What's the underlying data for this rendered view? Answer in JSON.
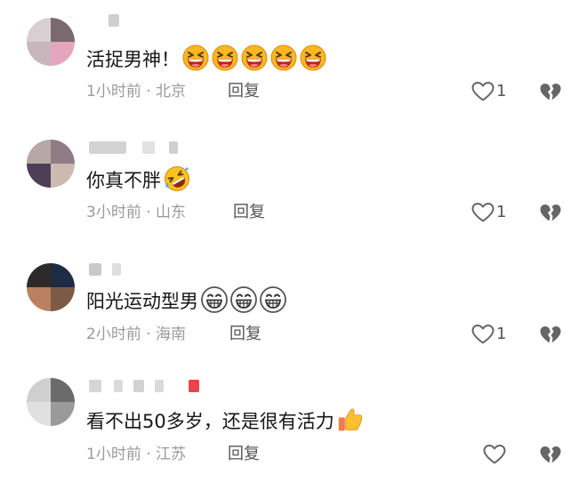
{
  "comments": [
    {
      "text": "活捉男神！",
      "emoji_icons": [
        "grinning-squinting-face-icon",
        "grinning-squinting-face-icon",
        "grinning-squinting-face-icon",
        "grinning-squinting-face-icon",
        "grinning-squinting-face-icon"
      ],
      "time_location": "1小时前 · 北京",
      "reply_label": "回复",
      "like_count": "1"
    },
    {
      "text": "你真不胖",
      "emoji_icons": [
        "rolling-on-floor-laughing-icon"
      ],
      "time_location": "3小时前 · 山东",
      "reply_label": "回复",
      "like_count": "1"
    },
    {
      "text": "阳光运动型男",
      "emoji_icons": [
        "beaming-face-icon",
        "beaming-face-icon",
        "beaming-face-icon"
      ],
      "time_location": "2小时前 · 海南",
      "reply_label": "回复",
      "like_count": "1"
    },
    {
      "text": "看不出50多岁，还是很有活力",
      "emoji_icons": [
        "thumbs-up-icon"
      ],
      "time_location": "1小时前 · 江苏",
      "reply_label": "回复",
      "like_count": ""
    }
  ],
  "colors": {
    "text": "#161616",
    "meta": "#9a9a9a",
    "icon": "#666666",
    "emoji_yellow": "#f7b01f",
    "emoji_mouth": "#c0392b"
  }
}
